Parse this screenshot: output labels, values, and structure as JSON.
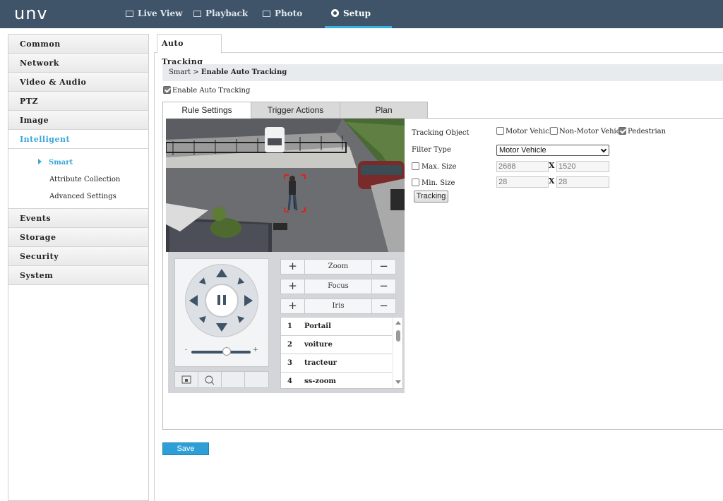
{
  "brand": {
    "logo": "unv"
  },
  "nav": {
    "live_view": "Live View",
    "playback": "Playback",
    "photo": "Photo",
    "setup": "Setup"
  },
  "sidebar": {
    "items": [
      "Common",
      "Network",
      "Video & Audio",
      "PTZ",
      "Image",
      "Intelligent",
      "Events",
      "Storage",
      "Security",
      "System"
    ],
    "active": "Intelligent",
    "sub_items": [
      "Smart",
      "Attribute Collection",
      "Advanced Settings"
    ],
    "active_sub": "Smart"
  },
  "content_tab": "Auto Tracking",
  "breadcrumb": {
    "parent": "Smart",
    "separator": ">",
    "current": "Enable Auto Tracking"
  },
  "enable_auto_tracking": {
    "label": "Enable Auto Tracking",
    "checked": true
  },
  "rule_tabs": {
    "rule_settings": "Rule Settings",
    "trigger_actions": "Trigger Actions",
    "plan": "Plan",
    "active": "Rule Settings"
  },
  "ptz": {
    "zoom": "Zoom",
    "focus": "Focus",
    "iris": "Iris",
    "slider_min": "-",
    "slider_max": "+",
    "speed_level": 0.6,
    "presets": [
      {
        "num": "1",
        "name": "Portail"
      },
      {
        "num": "2",
        "name": "voiture"
      },
      {
        "num": "3",
        "name": "tracteur"
      },
      {
        "num": "4",
        "name": "ss-zoom"
      }
    ]
  },
  "form": {
    "tracking_object_label": "Tracking Object",
    "objects": {
      "motor_vehicle": {
        "label": "Motor Vehicle",
        "checked": false
      },
      "non_motor_vehicle": {
        "label": "Non-Motor Vehicle",
        "checked": false
      },
      "pedestrian": {
        "label": "Pedestrian",
        "checked": true
      }
    },
    "filter_type_label": "Filter Type",
    "filter_type_value": "Motor Vehicle",
    "max_size": {
      "label": "Max. Size",
      "checked": false,
      "width": "2688",
      "height": "1520"
    },
    "min_size": {
      "label": "Min. Size",
      "checked": false,
      "width": "28",
      "height": "28"
    },
    "x_sep": "X",
    "tracking_button": "Tracking"
  },
  "save_button": "Save",
  "colors": {
    "topbar": "#3f5468",
    "accent": "#3aa6d8",
    "save": "#2d9fd6",
    "tracking_box": "#e0201c"
  }
}
